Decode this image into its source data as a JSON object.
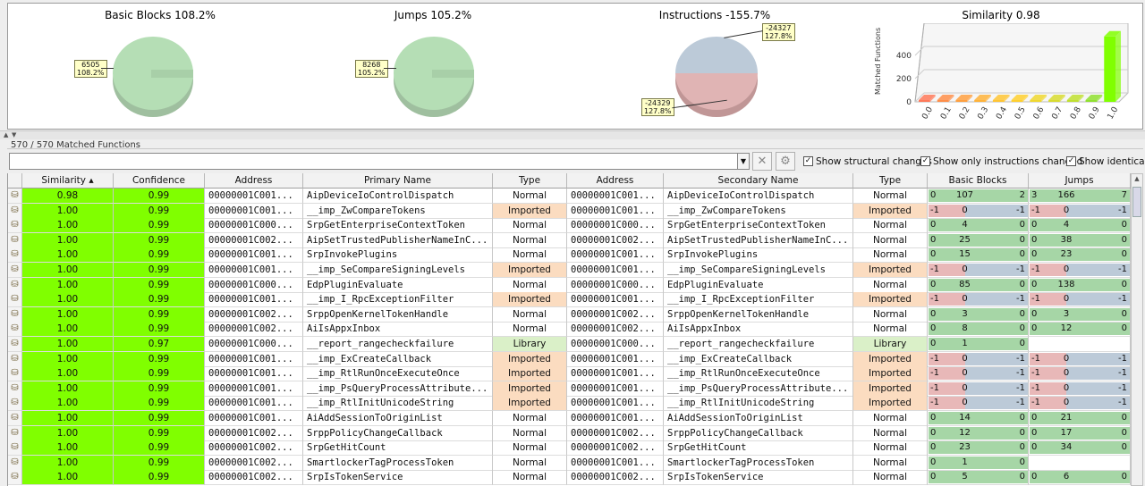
{
  "charts": [
    {
      "title": "Basic Blocks 108.2%",
      "label": [
        "6505",
        "108.2%"
      ]
    },
    {
      "title": "Jumps 105.2%",
      "label": [
        "8268",
        "105.2%"
      ]
    },
    {
      "title": "Instructions -155.7%",
      "label_top": [
        "-24327",
        "127.8%"
      ],
      "label_bottom": [
        "-24329",
        "127.8%"
      ]
    },
    {
      "title": "Similarity 0.98"
    }
  ],
  "chart_data": [
    {
      "type": "pie",
      "title": "Basic Blocks 108.2%",
      "slices": [
        {
          "label": "6505",
          "value": 108.2
        }
      ]
    },
    {
      "type": "pie",
      "title": "Jumps 105.2%",
      "slices": [
        {
          "label": "8268",
          "value": 105.2
        }
      ]
    },
    {
      "type": "pie",
      "title": "Instructions -155.7%",
      "slices": [
        {
          "label": "-24327",
          "value": 127.8
        },
        {
          "label": "-24329",
          "value": 127.8
        }
      ]
    },
    {
      "type": "bar",
      "title": "Similarity 0.98",
      "ylabel": "Matched Functions",
      "categories": [
        "0.0",
        "0.1",
        "0.2",
        "0.3",
        "0.4",
        "0.5",
        "0.6",
        "0.7",
        "0.8",
        "0.9",
        "1.0"
      ],
      "values": [
        0,
        0,
        0,
        0,
        0,
        0,
        0,
        0,
        0,
        7,
        563
      ],
      "yticks": [
        "0",
        "200",
        "400"
      ],
      "ylim": [
        0,
        600
      ]
    }
  ],
  "count_text": "570 / 570 Matched Functions",
  "toolbar": {
    "filter_value": "",
    "dropdown": "▼",
    "clear": "✕",
    "settings": "⚙"
  },
  "checkboxes": [
    {
      "label": "Show structural changes",
      "checked": true
    },
    {
      "label": "Show only instructions changed",
      "checked": true
    },
    {
      "label": "Show identical",
      "checked": true
    }
  ],
  "columns": [
    "Similarity",
    "Confidence",
    "Address",
    "Primary Name",
    "Type",
    "Address",
    "Secondary Name",
    "Type",
    "Basic Blocks",
    "Jumps"
  ],
  "sort_marker": "Similarity ▴",
  "colors": {
    "similarity": "#80ff00",
    "imported": "#fbdcc0",
    "library": "#daf0c8",
    "bb_green": "#a6d6a6",
    "bb_red": "#e8b8b8",
    "bb_blue": "#bccad8"
  },
  "rows": [
    {
      "sim": "0.98",
      "conf": "0.99",
      "addr1": "00000001C001...",
      "name1": "AipDeviceIoControlDispatch",
      "type1": "Normal",
      "addr2": "00000001C001...",
      "name2": "AipDeviceIoControlDispatch",
      "type2": "Normal",
      "bb": [
        "0",
        "107",
        "2"
      ],
      "jp": [
        "3",
        "166",
        "7"
      ]
    },
    {
      "sim": "1.00",
      "conf": "0.99",
      "addr1": "00000001C001...",
      "name1": "__imp_ZwCompareTokens",
      "type1": "Imported",
      "addr2": "00000001C001...",
      "name2": "__imp_ZwCompareTokens",
      "type2": "Imported",
      "bb": [
        "-1",
        "0",
        "-1"
      ],
      "jp": [
        "-1",
        "0",
        "-1"
      ]
    },
    {
      "sim": "1.00",
      "conf": "0.99",
      "addr1": "00000001C000...",
      "name1": "SrpGetEnterpriseContextToken",
      "type1": "Normal",
      "addr2": "00000001C000...",
      "name2": "SrpGetEnterpriseContextToken",
      "type2": "Normal",
      "bb": [
        "0",
        "4",
        "0"
      ],
      "jp": [
        "0",
        "4",
        "0"
      ]
    },
    {
      "sim": "1.00",
      "conf": "0.99",
      "addr1": "00000001C002...",
      "name1": "AipSetTrustedPublisherNameInC...",
      "type1": "Normal",
      "addr2": "00000001C002...",
      "name2": "AipSetTrustedPublisherNameInC...",
      "type2": "Normal",
      "bb": [
        "0",
        "25",
        "0"
      ],
      "jp": [
        "0",
        "38",
        "0"
      ]
    },
    {
      "sim": "1.00",
      "conf": "0.99",
      "addr1": "00000001C001...",
      "name1": "SrpInvokePlugins",
      "type1": "Normal",
      "addr2": "00000001C001...",
      "name2": "SrpInvokePlugins",
      "type2": "Normal",
      "bb": [
        "0",
        "15",
        "0"
      ],
      "jp": [
        "0",
        "23",
        "0"
      ]
    },
    {
      "sim": "1.00",
      "conf": "0.99",
      "addr1": "00000001C001...",
      "name1": "__imp_SeCompareSigningLevels",
      "type1": "Imported",
      "addr2": "00000001C001...",
      "name2": "__imp_SeCompareSigningLevels",
      "type2": "Imported",
      "bb": [
        "-1",
        "0",
        "-1"
      ],
      "jp": [
        "-1",
        "0",
        "-1"
      ]
    },
    {
      "sim": "1.00",
      "conf": "0.99",
      "addr1": "00000001C000...",
      "name1": "EdpPluginEvaluate",
      "type1": "Normal",
      "addr2": "00000001C000...",
      "name2": "EdpPluginEvaluate",
      "type2": "Normal",
      "bb": [
        "0",
        "85",
        "0"
      ],
      "jp": [
        "0",
        "138",
        "0"
      ]
    },
    {
      "sim": "1.00",
      "conf": "0.99",
      "addr1": "00000001C001...",
      "name1": "__imp_I_RpcExceptionFilter",
      "type1": "Imported",
      "addr2": "00000001C001...",
      "name2": "__imp_I_RpcExceptionFilter",
      "type2": "Imported",
      "bb": [
        "-1",
        "0",
        "-1"
      ],
      "jp": [
        "-1",
        "0",
        "-1"
      ]
    },
    {
      "sim": "1.00",
      "conf": "0.99",
      "addr1": "00000001C002...",
      "name1": "SrppOpenKernelTokenHandle",
      "type1": "Normal",
      "addr2": "00000001C002...",
      "name2": "SrppOpenKernelTokenHandle",
      "type2": "Normal",
      "bb": [
        "0",
        "3",
        "0"
      ],
      "jp": [
        "0",
        "3",
        "0"
      ]
    },
    {
      "sim": "1.00",
      "conf": "0.99",
      "addr1": "00000001C002...",
      "name1": "AiIsAppxInbox",
      "type1": "Normal",
      "addr2": "00000001C002...",
      "name2": "AiIsAppxInbox",
      "type2": "Normal",
      "bb": [
        "0",
        "8",
        "0"
      ],
      "jp": [
        "0",
        "12",
        "0"
      ]
    },
    {
      "sim": "1.00",
      "conf": "0.97",
      "addr1": "00000001C000...",
      "name1": "__report_rangecheckfailure",
      "type1": "Library",
      "addr2": "00000001C000...",
      "name2": "__report_rangecheckfailure",
      "type2": "Library",
      "bb": [
        "0",
        "1",
        "0"
      ],
      "jp": null
    },
    {
      "sim": "1.00",
      "conf": "0.99",
      "addr1": "00000001C001...",
      "name1": "__imp_ExCreateCallback",
      "type1": "Imported",
      "addr2": "00000001C001...",
      "name2": "__imp_ExCreateCallback",
      "type2": "Imported",
      "bb": [
        "-1",
        "0",
        "-1"
      ],
      "jp": [
        "-1",
        "0",
        "-1"
      ]
    },
    {
      "sim": "1.00",
      "conf": "0.99",
      "addr1": "00000001C001...",
      "name1": "__imp_RtlRunOnceExecuteOnce",
      "type1": "Imported",
      "addr2": "00000001C001...",
      "name2": "__imp_RtlRunOnceExecuteOnce",
      "type2": "Imported",
      "bb": [
        "-1",
        "0",
        "-1"
      ],
      "jp": [
        "-1",
        "0",
        "-1"
      ]
    },
    {
      "sim": "1.00",
      "conf": "0.99",
      "addr1": "00000001C001...",
      "name1": "__imp_PsQueryProcessAttribute...",
      "type1": "Imported",
      "addr2": "00000001C001...",
      "name2": "__imp_PsQueryProcessAttribute...",
      "type2": "Imported",
      "bb": [
        "-1",
        "0",
        "-1"
      ],
      "jp": [
        "-1",
        "0",
        "-1"
      ]
    },
    {
      "sim": "1.00",
      "conf": "0.99",
      "addr1": "00000001C001...",
      "name1": "__imp_RtlInitUnicodeString",
      "type1": "Imported",
      "addr2": "00000001C001...",
      "name2": "__imp_RtlInitUnicodeString",
      "type2": "Imported",
      "bb": [
        "-1",
        "0",
        "-1"
      ],
      "jp": [
        "-1",
        "0",
        "-1"
      ]
    },
    {
      "sim": "1.00",
      "conf": "0.99",
      "addr1": "00000001C001...",
      "name1": "AiAddSessionToOriginList",
      "type1": "Normal",
      "addr2": "00000001C001...",
      "name2": "AiAddSessionToOriginList",
      "type2": "Normal",
      "bb": [
        "0",
        "14",
        "0"
      ],
      "jp": [
        "0",
        "21",
        "0"
      ]
    },
    {
      "sim": "1.00",
      "conf": "0.99",
      "addr1": "00000001C002...",
      "name1": "SrppPolicyChangeCallback",
      "type1": "Normal",
      "addr2": "00000001C002...",
      "name2": "SrppPolicyChangeCallback",
      "type2": "Normal",
      "bb": [
        "0",
        "12",
        "0"
      ],
      "jp": [
        "0",
        "17",
        "0"
      ]
    },
    {
      "sim": "1.00",
      "conf": "0.99",
      "addr1": "00000001C002...",
      "name1": "SrpGetHitCount",
      "type1": "Normal",
      "addr2": "00000001C002...",
      "name2": "SrpGetHitCount",
      "type2": "Normal",
      "bb": [
        "0",
        "23",
        "0"
      ],
      "jp": [
        "0",
        "34",
        "0"
      ]
    },
    {
      "sim": "1.00",
      "conf": "0.99",
      "addr1": "00000001C002...",
      "name1": "SmartlockerTagProcessToken",
      "type1": "Normal",
      "addr2": "00000001C001...",
      "name2": "SmartlockerTagProcessToken",
      "type2": "Normal",
      "bb": [
        "0",
        "1",
        "0"
      ],
      "jp": null
    },
    {
      "sim": "1.00",
      "conf": "0.99",
      "addr1": "00000001C002...",
      "name1": "SrpIsTokenService",
      "type1": "Normal",
      "addr2": "00000001C002...",
      "name2": "SrpIsTokenService",
      "type2": "Normal",
      "bb": [
        "0",
        "5",
        "0"
      ],
      "jp": [
        "0",
        "6",
        "0"
      ]
    }
  ]
}
